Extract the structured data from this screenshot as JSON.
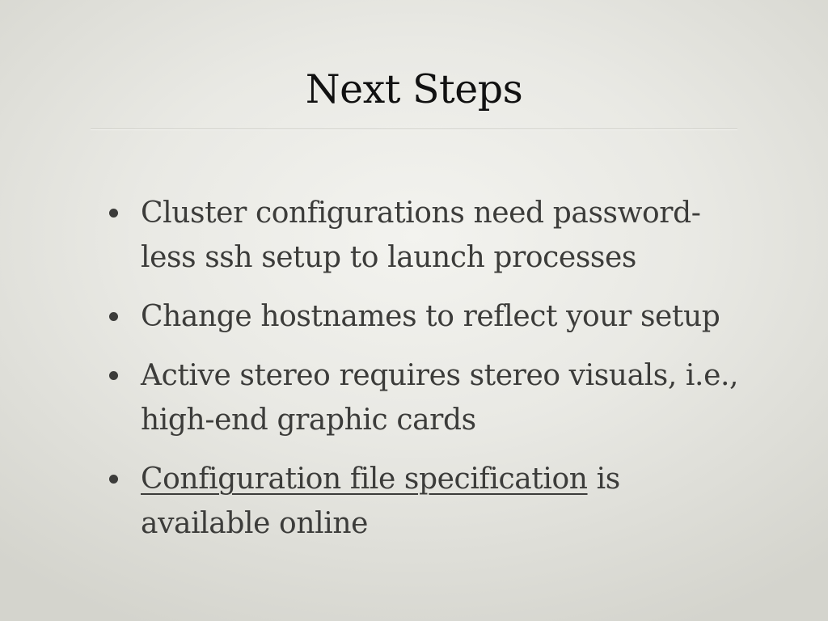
{
  "slide": {
    "title": "Next Steps",
    "bullets": [
      {
        "text": "Cluster configurations need password-less ssh setup to launch processes"
      },
      {
        "text": "Change hostnames to reflect your setup"
      },
      {
        "text": "Active stereo requires stereo visuals, i.e., high-end graphic cards"
      },
      {
        "link_text": "Configuration file specification",
        "text_after": " is available online"
      }
    ]
  }
}
